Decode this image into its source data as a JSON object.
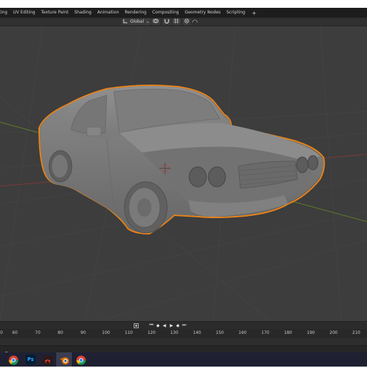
{
  "workspace_tabs": [
    "lting",
    "UV Editing",
    "Texture Paint",
    "Shading",
    "Animation",
    "Rendering",
    "Compositing",
    "Geometry Nodes",
    "Scripting"
  ],
  "add_workspace_label": "+",
  "header": {
    "transform_orientation": "Global",
    "orientation_icon": "orientation-gizmo-icon",
    "pivot_icon": "pivot-icon",
    "snap_icon": "snap-magnet-icon",
    "proportional_icon": "proportional-edit-icon"
  },
  "viewport": {
    "object": "car-model",
    "selection_outline_color": "#e8841a",
    "background_color": "#3d3d3d",
    "x_axis_color": "#8c3a3a",
    "y_axis_color": "#6a8c2a"
  },
  "playback": {
    "buttons": [
      "jump-start",
      "prev-keyframe",
      "play-reverse",
      "play",
      "next-keyframe",
      "jump-end"
    ],
    "glyphs": [
      "⏮",
      "◆",
      "◀",
      "▶",
      "◆",
      "⏭"
    ]
  },
  "timeline": {
    "frame_ticks": [
      "60",
      "70",
      "80",
      "90",
      "100",
      "110",
      "120",
      "130",
      "140",
      "150",
      "160",
      "170",
      "180",
      "190",
      "200",
      "210"
    ],
    "left_partial_tick": "0"
  },
  "taskbar": {
    "apps": [
      "chrome",
      "photoshop",
      "acrobat",
      "blender",
      "chrome-2"
    ],
    "ps_label": "Ps"
  }
}
